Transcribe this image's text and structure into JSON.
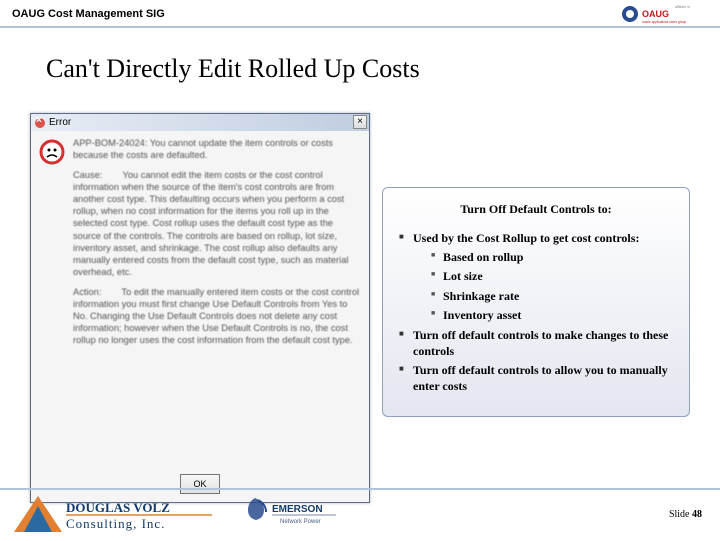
{
  "header": {
    "title": "OAUG Cost Management SIG",
    "logo_alt": "OAUG affiliate logo"
  },
  "slide": {
    "title": "Can't Directly Edit Rolled Up Costs"
  },
  "dialog": {
    "title": "Error",
    "close_label": "×",
    "ok_label": "OK",
    "p1": "APP-BOM-24024: You cannot update the item controls or costs because the costs are defaulted.",
    "p2_lead": "Cause:",
    "p2_body": "You cannot edit the item costs or the cost control information when the source of the item's cost controls are from another cost type. This defaulting occurs when you perform a cost rollup, when no cost information for the items you roll up in the selected cost type. Cost rollup uses the default cost type as the source of the controls. The controls are based on rollup, lot size, inventory asset, and shrinkage. The cost rollup also defaults any manually entered costs from the default cost type, such as material overhead, etc.",
    "p3_lead": "Action:",
    "p3_body": "To edit the manually entered item costs or the cost control information you must first change Use Default Controls from Yes to No. Changing the Use Default Controls does not delete any cost information; however when the Use Default Controls is no, the cost rollup no longer uses the cost information from the default cost type."
  },
  "callout": {
    "title": "Turn Off Default Controls to:",
    "l1": "Used by the Cost Rollup to get cost controls:",
    "l1a": "Based on rollup",
    "l1b": "Lot size",
    "l1c": "Shrinkage rate",
    "l1d": "Inventory asset",
    "l2": "Turn off default controls to make changes to these controls",
    "l3": "Turn off default controls to allow you to manually enter costs"
  },
  "footer": {
    "slide_label": "Slide ",
    "slide_num": "48",
    "logo1_alt": "Douglas Volz Consulting, Inc.",
    "logo2_alt": "Emerson Network Power"
  }
}
